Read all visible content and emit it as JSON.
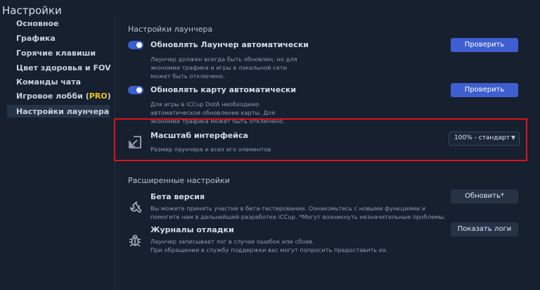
{
  "app": {
    "title": "Настройки"
  },
  "sidebar": {
    "items": [
      {
        "label": "Основное"
      },
      {
        "label": "Графика"
      },
      {
        "label": "Горячие клавиши"
      },
      {
        "label": "Цвет здоровья и FOV"
      },
      {
        "label": "Команды чата"
      },
      {
        "label": "Игровое лобби (",
        "badge": "PRO",
        "suffix": ")"
      },
      {
        "label": "Настройки лаунчера",
        "active": true
      }
    ]
  },
  "launcher_settings": {
    "section_title": "Настройки лаунчера",
    "auto_update_launcher": {
      "title": "Обновлять Лаунчер автоматически",
      "enabled": true,
      "desc": [
        "Лаунчер должен всегда быть обновлен, но для",
        "экономии трафика и игры в локальной сети",
        "может быть отключено."
      ],
      "button": "Проверить"
    },
    "auto_update_map": {
      "title": "Обновлять карту автоматически",
      "enabled": true,
      "desc": [
        "Для игры в iCCup DotA необходимо",
        "автоматическое обновление карты. Для",
        "экономии трафика может быть отключено."
      ],
      "button": "Проверить"
    },
    "scale": {
      "title": "Масштаб интерфейса",
      "desc": "Размер лаунчера и всех его элементов",
      "selected": "100% - стандарт",
      "icon": "resize-icon"
    }
  },
  "advanced": {
    "section_title": "Расширенные настройки",
    "beta": {
      "title": "Бета версия",
      "desc": [
        "Вы можете принять участие в бета-тестировании. Ознакомьтесь с новыми функциями и",
        "помогите нам в дальнейшей разработке iCCup. *Могут возникнуть незначительные проблемы."
      ],
      "button": "Обновить*",
      "icon": "wrench-icon"
    },
    "debug_logs": {
      "title": "Журналы отладки",
      "desc": [
        "Лаунчер записывает лог в случае ошибок или сбоев.",
        "При обращении в службу поддержки вас могут попросить предоставить их."
      ],
      "button": "Показать логи",
      "icon": "bug-icon"
    }
  },
  "colors": {
    "accent": "#3f5fd0",
    "highlight": "#e0121a",
    "pro": "#f0c419",
    "background": "#16202f"
  }
}
